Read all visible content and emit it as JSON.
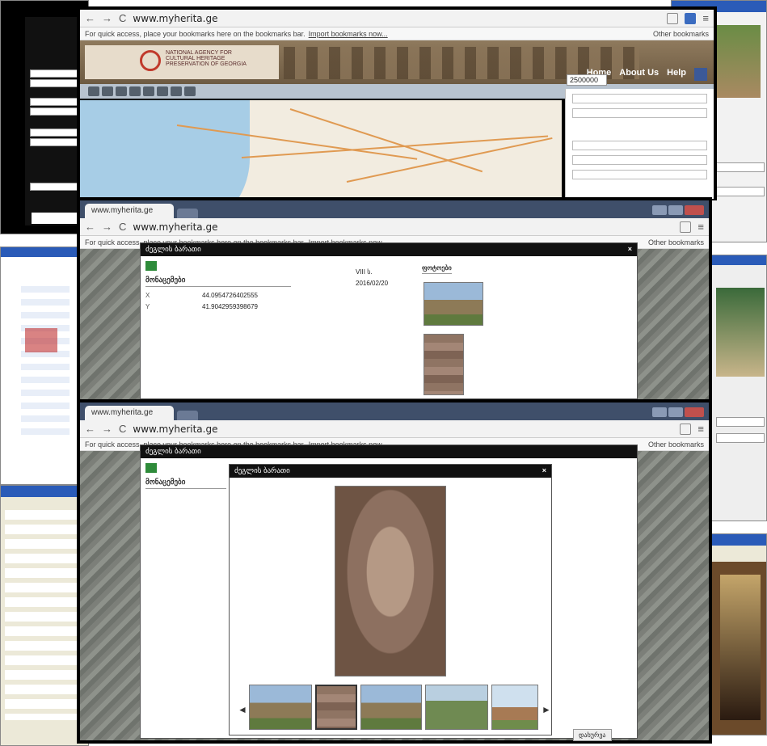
{
  "browser": {
    "url": "www.myherita.ge",
    "tab_label": "www.myherita.ge",
    "bookmarks_prompt": "For quick access, place your bookmarks here on the bookmarks bar.",
    "import_link": "Import bookmarks now...",
    "other_bookmarks": "Other bookmarks"
  },
  "site": {
    "agency_line1": "NATIONAL AGENCY FOR",
    "agency_line2": "CULTURAL HERITAGE",
    "agency_line3": "PRESERVATION OF GEORGIA",
    "menu": [
      "Home",
      "About Us",
      "Help"
    ],
    "scale_value": "2500000"
  },
  "dialog": {
    "title": "ძეგლის ბარათი",
    "section_photos": "ფოტოები",
    "section_details": "მონაცემები",
    "coords": {
      "x_label": "X",
      "x_value": "44.0954726402555",
      "y_label": "Y",
      "y_value": "41.9042959398679"
    },
    "photos_header": "ფოტოები",
    "date_value": "2016/02/20",
    "century_value": "VIII ს.",
    "close_button": "დახურვა"
  }
}
